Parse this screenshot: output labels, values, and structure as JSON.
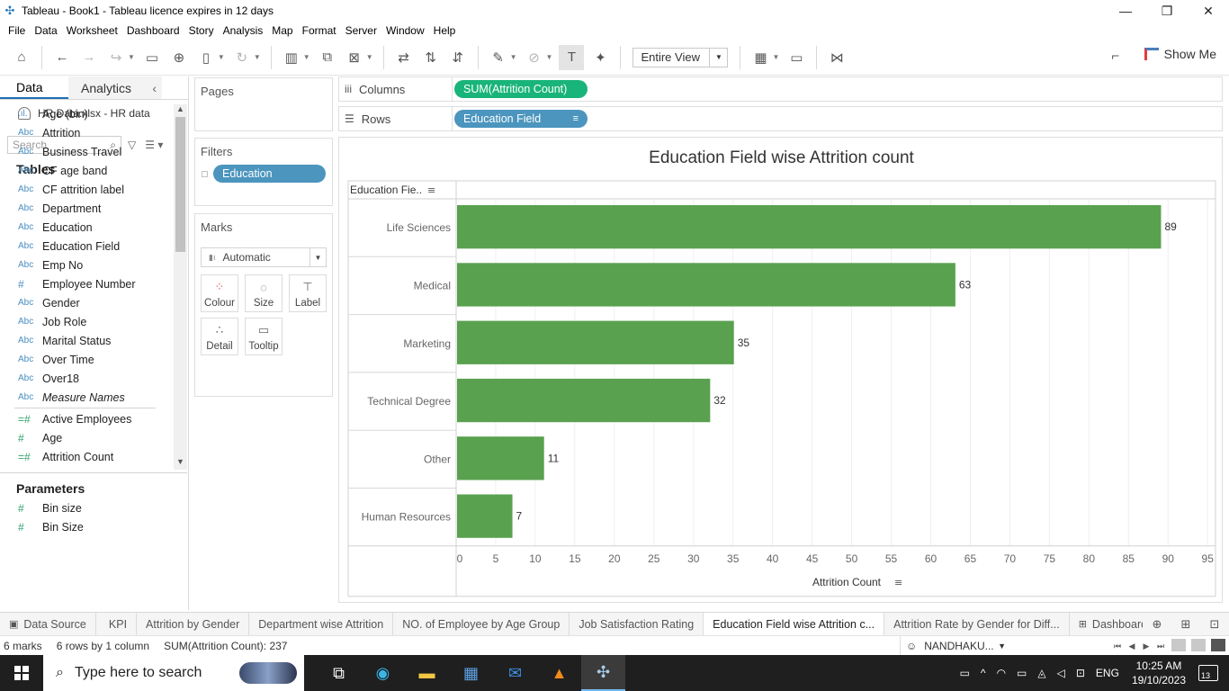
{
  "window": {
    "title": "Tableau - Book1 - Tableau licence expires in 12 days"
  },
  "menu": [
    "File",
    "Data",
    "Worksheet",
    "Dashboard",
    "Story",
    "Analysis",
    "Map",
    "Format",
    "Server",
    "Window",
    "Help"
  ],
  "toolbar": {
    "view_mode": "Entire View",
    "show_me_label": "Show Me"
  },
  "data_pane": {
    "tab_data": "Data",
    "tab_analytics": "Analytics",
    "datasource": "HR Data.xlsx - HR data",
    "search_placeholder": "Search",
    "tables_heading": "Tables",
    "dimensions": [
      {
        "type": "bin",
        "label": "Age (bin)"
      },
      {
        "type": "Abc",
        "label": "Attrition"
      },
      {
        "type": "Abc",
        "label": "Business Travel"
      },
      {
        "type": "Abc",
        "label": "CF age band"
      },
      {
        "type": "Abc",
        "label": "CF attrition label"
      },
      {
        "type": "Abc",
        "label": "Department"
      },
      {
        "type": "Abc",
        "label": "Education"
      },
      {
        "type": "Abc",
        "label": "Education Field"
      },
      {
        "type": "Abc",
        "label": "Emp No"
      },
      {
        "type": "#",
        "label": "Employee Number"
      },
      {
        "type": "Abc",
        "label": "Gender"
      },
      {
        "type": "Abc",
        "label": "Job Role"
      },
      {
        "type": "Abc",
        "label": "Marital Status"
      },
      {
        "type": "Abc",
        "label": "Over Time"
      },
      {
        "type": "Abc",
        "label": "Over18"
      },
      {
        "type": "Abc",
        "label": "Measure Names"
      }
    ],
    "measures": [
      {
        "type": "=#",
        "label": "Active Employees"
      },
      {
        "type": "#",
        "label": "Age"
      },
      {
        "type": "=#",
        "label": "Attrition Count"
      }
    ],
    "parameters_heading": "Parameters",
    "parameters": [
      {
        "type": "#",
        "label": "Bin size"
      },
      {
        "type": "#",
        "label": "Bin Size"
      }
    ]
  },
  "cards": {
    "pages_title": "Pages",
    "filters_title": "Filters",
    "filter_pill": "Education",
    "marks_title": "Marks",
    "marks_type": "Automatic",
    "mark_buttons": [
      "Colour",
      "Size",
      "Label",
      "Detail",
      "Tooltip"
    ]
  },
  "shelves": {
    "columns_label": "Columns",
    "columns_pill": "SUM(Attrition Count)",
    "rows_label": "Rows",
    "rows_pill": "Education Field"
  },
  "chart_data": {
    "type": "bar",
    "orientation": "horizontal",
    "title": "Education Field wise Attrition count",
    "row_header": "Education Fie..",
    "xlabel": "Attrition Count",
    "categories": [
      "Life Sciences",
      "Medical",
      "Marketing",
      "Technical Degree",
      "Other",
      "Human Resources"
    ],
    "values": [
      89,
      63,
      35,
      32,
      11,
      7
    ],
    "xlim": [
      0,
      96
    ],
    "xticks": [
      0,
      5,
      10,
      15,
      20,
      25,
      30,
      35,
      40,
      45,
      50,
      55,
      60,
      65,
      70,
      75,
      80,
      85,
      90,
      95
    ],
    "bar_color": "#59a14f",
    "data_labels": true,
    "grid": "vertical"
  },
  "sheet_tabs": [
    {
      "label": "Data Source",
      "icon": "datasource"
    },
    {
      "label": "KPI"
    },
    {
      "label": "Attrition by Gender"
    },
    {
      "label": "Department wise Attrition"
    },
    {
      "label": "NO. of Employee by Age Group"
    },
    {
      "label": "Job Satisfaction Rating"
    },
    {
      "label": "Education Field wise Attrition c...",
      "active": true
    },
    {
      "label": "Attrition Rate by Gender for Diff..."
    },
    {
      "label": "Dashboard",
      "icon": "dashboard"
    }
  ],
  "status": {
    "marks": "6 marks",
    "rows_cols": "6 rows by 1 column",
    "sum": "SUM(Attrition Count): 237",
    "user": "NANDHAKU..."
  },
  "taskbar": {
    "search_placeholder": "Type here to search",
    "lang": "ENG",
    "time": "10:25 AM",
    "date": "19/10/2023",
    "notifications": "13"
  }
}
